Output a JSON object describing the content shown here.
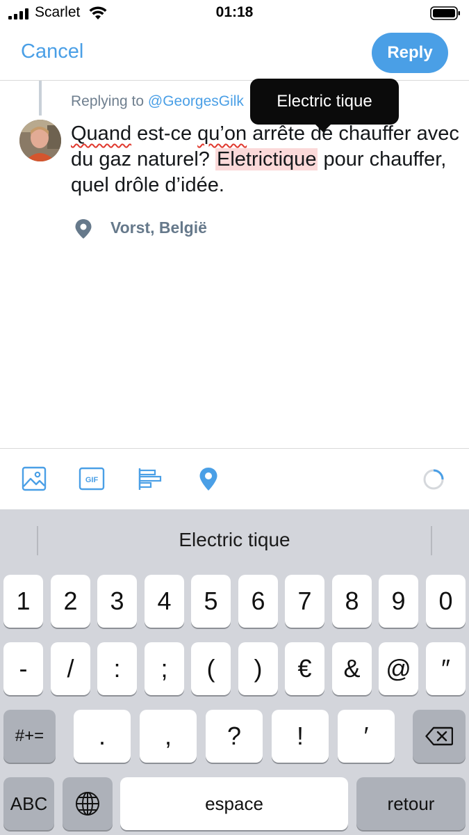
{
  "status_bar": {
    "carrier": "Scarlet",
    "time": "01:18"
  },
  "header": {
    "cancel_label": "Cancel",
    "reply_label": "Reply"
  },
  "compose": {
    "replying_prefix": "Replying to",
    "replying_handle": "@GeorgesGilk",
    "text_parts": {
      "w1": "Quand",
      "t1": " est-ce ",
      "w2": "qu’on",
      "t2": " arrête de chauffer avec du gaz naturel? ",
      "w3": "Eletrictique",
      "t3": " pour chauffer, quel drôle d’idée."
    },
    "location": "Vorst, België"
  },
  "tooltip": {
    "text": "Electric tique"
  },
  "toolbar": {
    "icons": [
      "image-icon",
      "gif-icon",
      "poll-icon",
      "location-pin-icon",
      "character-count-ring-icon"
    ],
    "gif_label": "GIF",
    "accent_color": "#4a9fe6"
  },
  "keyboard": {
    "suggestion": "Electric tique",
    "row1": [
      "1",
      "2",
      "3",
      "4",
      "5",
      "6",
      "7",
      "8",
      "9",
      "0"
    ],
    "row2": [
      "-",
      "/",
      ":",
      ";",
      "(",
      ")",
      "€",
      "&",
      "@",
      "″"
    ],
    "row3_left": "#+=",
    "row3": [
      ".",
      ",",
      "?",
      "!",
      "′"
    ],
    "row4": {
      "abc": "ABC",
      "space": "espace",
      "return": "retour"
    }
  }
}
